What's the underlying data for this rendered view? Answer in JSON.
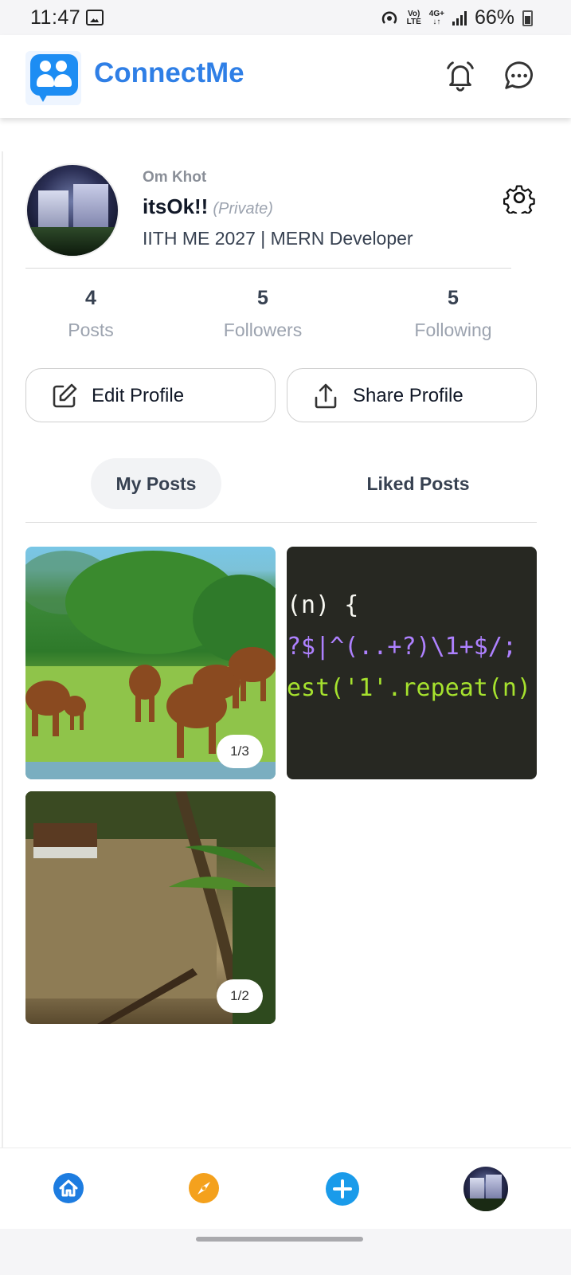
{
  "status_bar": {
    "time": "11:47",
    "battery": "66%",
    "network_top": "Vo)",
    "network_bottom": "LTE",
    "data_top": "4G+",
    "data_bottom": "↓↑"
  },
  "header": {
    "app_name": "ConnectMe",
    "icons": [
      "logo-icon",
      "bell-icon",
      "chat-icon"
    ]
  },
  "profile": {
    "username": "Om Khot",
    "display_name": "itsOk!!",
    "privacy": "(Private)",
    "bio": "IITH ME 2027 | MERN Developer",
    "stats": [
      {
        "value": "4",
        "label": "Posts"
      },
      {
        "value": "5",
        "label": "Followers"
      },
      {
        "value": "5",
        "label": "Following"
      }
    ]
  },
  "actions": {
    "edit_label": "Edit Profile",
    "share_label": "Share Profile"
  },
  "tabs": [
    {
      "label": "My Posts",
      "active": true
    },
    {
      "label": "Liked Posts",
      "active": false
    }
  ],
  "posts": [
    {
      "description": "elephants-grazing",
      "badge": "1/3"
    },
    {
      "description": "code-snippet",
      "badge": "",
      "code_lines": [
        "(n) {",
        "?$|^(..+?)\\1+$/;",
        "est('1'.repeat(n)"
      ]
    },
    {
      "description": "backwater-boat",
      "badge": "1/2"
    }
  ],
  "bottom_nav": {
    "items": [
      "home-icon",
      "explore-icon",
      "add-post-icon",
      "profile-avatar"
    ]
  },
  "colors": {
    "brand": "#2f7fe6",
    "logo": "#1d8df3",
    "home": "#1d7ce0",
    "explore": "#f4a11d",
    "add": "#1a9bea"
  }
}
